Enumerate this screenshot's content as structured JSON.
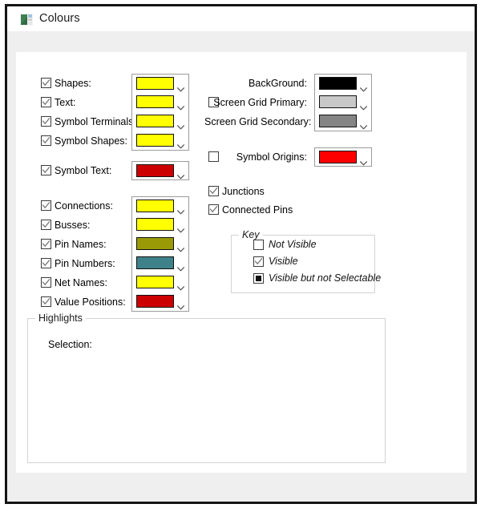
{
  "window": {
    "title": "Colours",
    "icon": "colours-app-icon"
  },
  "left_column": [
    {
      "label": "Shapes:",
      "checkbox": "checked",
      "color": "#ffff00"
    },
    {
      "label": "Text:",
      "checkbox": "checked",
      "color": "#ffff00"
    },
    {
      "label": "Symbol Terminals:",
      "checkbox": "checked",
      "color": "#ffff00"
    },
    {
      "label": "Symbol Shapes:",
      "checkbox": "checked",
      "color": "#ffff00"
    },
    {
      "label": "Symbol Text:",
      "checkbox": "checked",
      "color": "#cc0000"
    },
    {
      "label": "Connections:",
      "checkbox": "checked",
      "color": "#ffff00"
    },
    {
      "label": "Busses:",
      "checkbox": "checked",
      "color": "#ffff00"
    },
    {
      "label": "Pin Names:",
      "checkbox": "checked",
      "color": "#999a06"
    },
    {
      "label": "Pin Numbers:",
      "checkbox": "checked",
      "color": "#3f8189"
    },
    {
      "label": "Net Names:",
      "checkbox": "checked",
      "color": "#ffff00"
    },
    {
      "label": "Value Positions:",
      "checkbox": "checked",
      "color": "#cc0000"
    }
  ],
  "right_column": [
    {
      "label": "BackGround:",
      "checkbox": "none",
      "color": "#000000"
    },
    {
      "label": "Screen Grid Primary:",
      "checkbox": "unchecked",
      "color": "#c8c8c8"
    },
    {
      "label": "Screen Grid Secondary:",
      "checkbox": "none",
      "color": "#858585"
    },
    {
      "label": "Symbol Origins:",
      "checkbox": "unchecked",
      "color": "#fe0000"
    }
  ],
  "toggles": [
    {
      "label": "Junctions",
      "checkbox": "checked"
    },
    {
      "label": "Connected Pins",
      "checkbox": "checked"
    }
  ],
  "key_group": {
    "title": "Key",
    "items": [
      {
        "label": "Not Visible",
        "state": "unchecked"
      },
      {
        "label": "Visible",
        "state": "checked"
      },
      {
        "label": "Visible but not Selectable",
        "state": "filled"
      }
    ]
  },
  "highlights_group": {
    "title": "Highlights",
    "selection_label": "Selection:"
  }
}
